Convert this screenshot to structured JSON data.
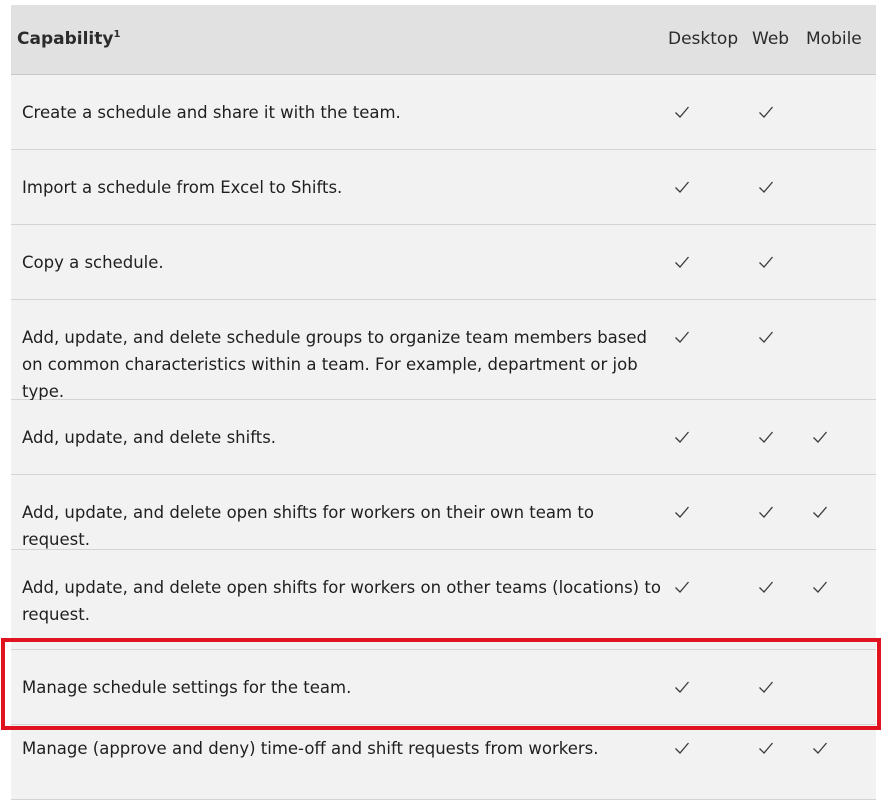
{
  "header": {
    "capability": "Capability",
    "capability_footnote": "1",
    "desktop": "Desktop",
    "web": "Web",
    "mobile": "Mobile"
  },
  "rows": [
    {
      "text": "Create a schedule and share it with the team.",
      "desktop": true,
      "web": true,
      "mobile": false
    },
    {
      "text": "Import a schedule from Excel to Shifts.",
      "desktop": true,
      "web": true,
      "mobile": false
    },
    {
      "text": "Copy a schedule.",
      "desktop": true,
      "web": true,
      "mobile": false
    },
    {
      "text": "Add, update, and delete schedule groups to organize team members based on common characteristics within a team. For example, department or job type.",
      "desktop": true,
      "web": true,
      "mobile": false
    },
    {
      "text": "Add, update, and delete shifts.",
      "desktop": true,
      "web": true,
      "mobile": true
    },
    {
      "text": "Add, update, and delete open shifts for workers on their own team to request.",
      "desktop": true,
      "web": true,
      "mobile": true
    },
    {
      "text": "Add, update, and delete open shifts for workers on other teams (locations) to request.",
      "desktop": true,
      "web": true,
      "mobile": true
    },
    {
      "text": "Manage schedule settings for the team.",
      "desktop": true,
      "web": true,
      "mobile": false
    },
    {
      "text": "Manage (approve and deny) time-off and shift requests from workers.",
      "desktop": true,
      "web": true,
      "mobile": true
    }
  ],
  "highlight_color": "#e0141e",
  "check_icon": "check-icon"
}
